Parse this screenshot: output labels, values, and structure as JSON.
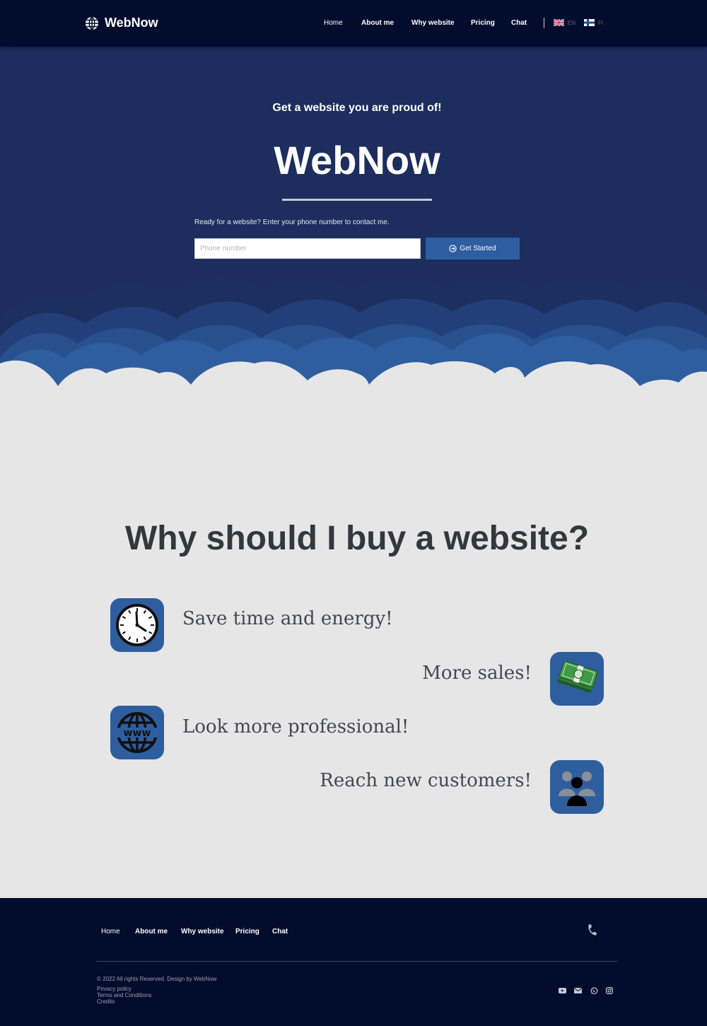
{
  "brand": "WebNow",
  "header": {
    "nav": [
      "Home",
      "About me",
      "Why website",
      "Pricing",
      "Chat"
    ],
    "languages": [
      {
        "code": "EN",
        "flag": "uk-flag-icon"
      },
      {
        "code": "FI",
        "flag": "finland-flag-icon"
      }
    ]
  },
  "hero": {
    "tagline": "Get a website you are proud of!",
    "title": "WebNow",
    "prompt": "Ready for a website? Enter your phone number to contact me.",
    "phone_placeholder": "Phone number",
    "cta_label": "Get Started",
    "cta_icon": "arrow-circle-icon"
  },
  "why": {
    "title": "Why should I buy a website?",
    "features": [
      {
        "text": "Save time and energy!",
        "icon": "clock-icon"
      },
      {
        "text": "More sales!",
        "icon": "money-icon"
      },
      {
        "text": "Look more professional!",
        "icon": "www-globe-icon"
      },
      {
        "text": "Reach new customers!",
        "icon": "people-icon"
      }
    ]
  },
  "footer": {
    "nav": [
      "Home",
      "About me",
      "Why website",
      "Pricing",
      "Chat"
    ],
    "copyright": "© 2022 All rights Reserved. Design by WebNow",
    "links": [
      "Privacy policy",
      "Terms and Conditions",
      "Credits"
    ],
    "social": [
      "youtube-icon",
      "email-icon",
      "whatsapp-icon",
      "instagram-icon"
    ]
  },
  "colors": {
    "header_bg": "#020c2c",
    "hero_bg": "#1c2d5e",
    "accent": "#2e5ea1",
    "section_bg": "#e6e6e7"
  }
}
